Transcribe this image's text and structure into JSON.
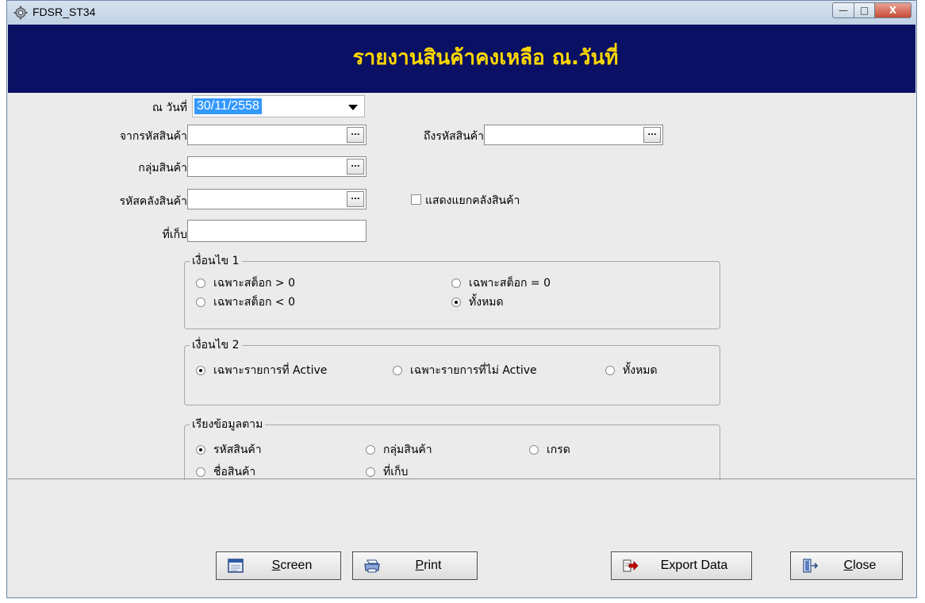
{
  "window": {
    "title": "FDSR_ST34",
    "minimize_glyph": "—",
    "maximize_glyph": "□",
    "close_glyph": "X",
    "icon": "gear-icon"
  },
  "header": {
    "title": "รายงานสินค้าคงเหลือ ณ.วันที่"
  },
  "form": {
    "as_of_date_label": "ณ วันที่",
    "as_of_date_value": "30/11/2558",
    "from_product_label": "จากรหัสสินค้า",
    "to_product_label": "ถึงรหัสสินค้า",
    "product_group_label": "กลุ่มสินค้า",
    "warehouse_code_label": "รหัสคลังสินค้า",
    "location_label": "ที่เก็บ",
    "browse_button_label": "...",
    "show_by_warehouse_label": "แสดงแยกคลังสินค้า",
    "show_by_warehouse_checked": false
  },
  "condition1": {
    "title": "เงื่อนไข 1",
    "options": [
      {
        "label": "เฉพาะสต็อก > 0",
        "selected": false
      },
      {
        "label": "เฉพาะสต็อก = 0",
        "selected": false
      },
      {
        "label": "เฉพาะสต็อก < 0",
        "selected": false
      },
      {
        "label": "ทั้งหมด",
        "selected": true
      }
    ]
  },
  "condition2": {
    "title": "เงื่อนไข 2",
    "options": [
      {
        "label": "เฉพาะรายการที่ Active",
        "selected": true
      },
      {
        "label": "เฉพาะรายการที่ไม่ Active",
        "selected": false
      },
      {
        "label": "ทั้งหมด",
        "selected": false
      }
    ]
  },
  "sort_by": {
    "title": "เรียงข้อมูลตาม",
    "options": [
      {
        "label": "รหัสสินค้า",
        "selected": true
      },
      {
        "label": "กลุ่มสินค้า",
        "selected": false
      },
      {
        "label": "เกรด",
        "selected": false
      },
      {
        "label": "ชื่อสินค้า",
        "selected": false
      },
      {
        "label": "ที่เก็บ",
        "selected": false
      }
    ]
  },
  "buttons": {
    "screen": {
      "label": "Screen",
      "mnemonic": "S",
      "rest": "creen",
      "icon": "screen-icon"
    },
    "print": {
      "label": "Print",
      "mnemonic": "P",
      "rest": "rint",
      "icon": "printer-icon"
    },
    "export": {
      "label": "Export Data",
      "icon": "export-icon"
    },
    "close": {
      "label": "Close",
      "mnemonic": "C",
      "rest": "lose",
      "icon": "exit-door-icon"
    }
  },
  "colors": {
    "header_background": "#0a1063",
    "header_text": "#ffd800",
    "date_selection": "#3399ff",
    "export_icon_arrow": "#cc0000"
  }
}
